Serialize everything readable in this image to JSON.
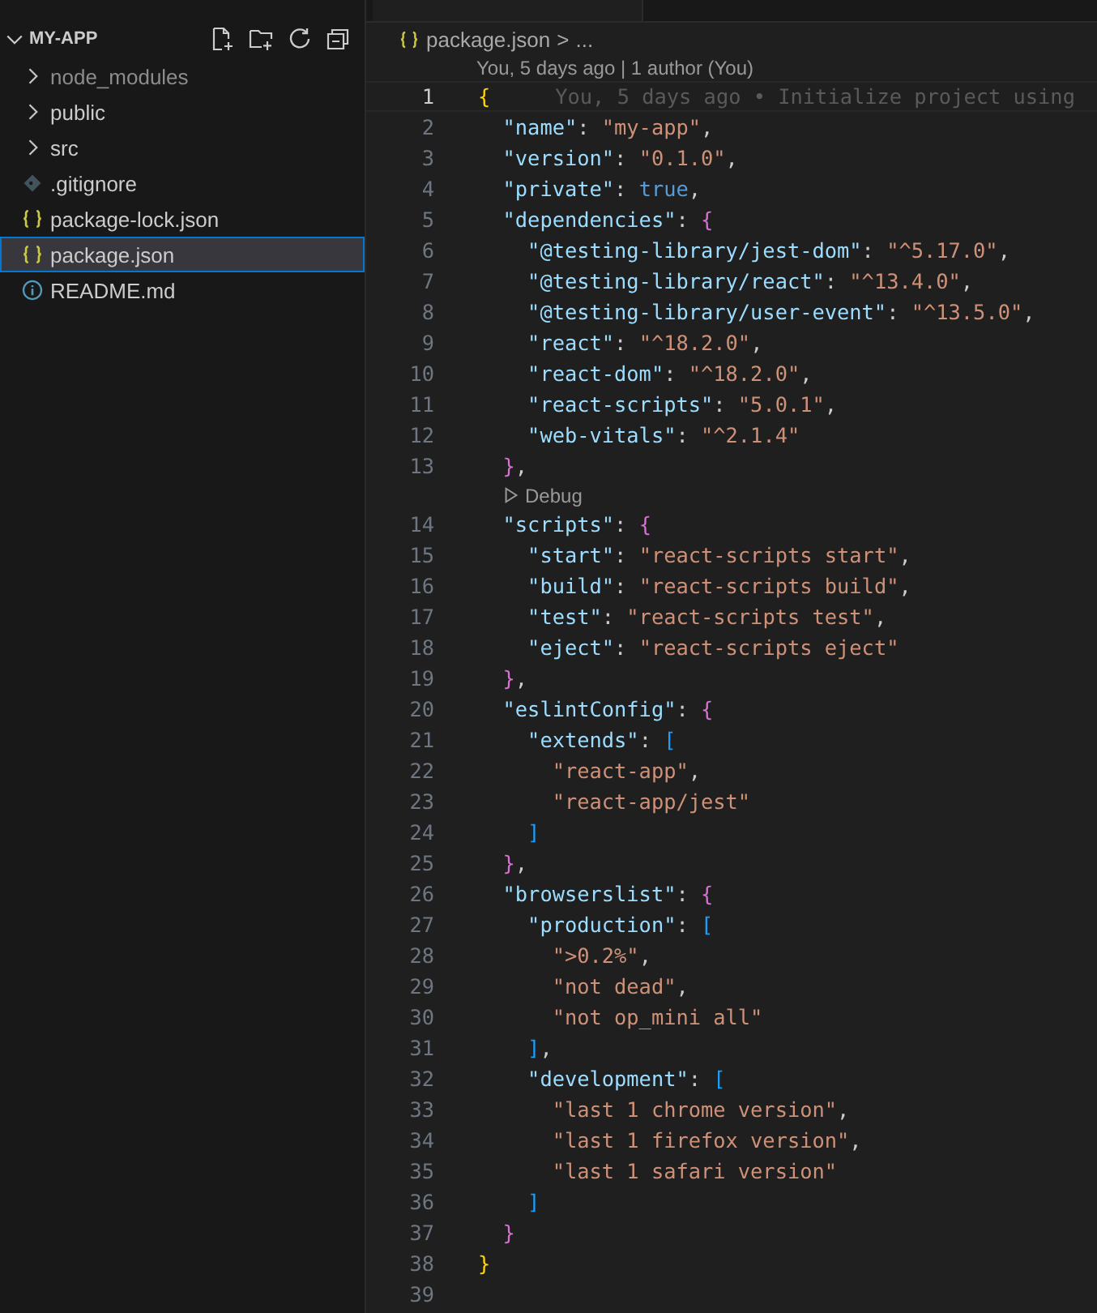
{
  "explorer": {
    "title": "MY-APP",
    "expanded": true,
    "items": [
      {
        "label": "node_modules",
        "kind": "folder",
        "ignored": true,
        "selected": false
      },
      {
        "label": "public",
        "kind": "folder",
        "ignored": false,
        "selected": false
      },
      {
        "label": "src",
        "kind": "folder",
        "ignored": false,
        "selected": false
      },
      {
        "label": ".gitignore",
        "kind": "git",
        "ignored": false,
        "selected": false
      },
      {
        "label": "package-lock.json",
        "kind": "json",
        "ignored": false,
        "selected": false
      },
      {
        "label": "package.json",
        "kind": "json",
        "ignored": false,
        "selected": true
      },
      {
        "label": "README.md",
        "kind": "info",
        "ignored": false,
        "selected": false
      }
    ]
  },
  "breadcrumb": {
    "file": "package.json",
    "separator": ">",
    "rest": "..."
  },
  "editor": {
    "items": [
      {
        "kind": "codelens",
        "text": "You, 5 days ago | 1 author (You)"
      },
      {
        "kind": "line",
        "number": "1",
        "current": true,
        "blame": "You, 5 days ago • Initialize project using",
        "tokens": [
          {
            "kind": "bracket",
            "text": "{",
            "color": "#ffd700"
          }
        ]
      },
      {
        "kind": "line",
        "number": "2",
        "current": false,
        "tokens": [
          {
            "kind": "key",
            "text": "  \"name\""
          },
          {
            "kind": "punct",
            "text": ": "
          },
          {
            "kind": "string",
            "text": "\"my-app\""
          },
          {
            "kind": "punct",
            "text": ","
          }
        ]
      },
      {
        "kind": "line",
        "number": "3",
        "current": false,
        "tokens": [
          {
            "kind": "key",
            "text": "  \"version\""
          },
          {
            "kind": "punct",
            "text": ": "
          },
          {
            "kind": "string",
            "text": "\"0.1.0\""
          },
          {
            "kind": "punct",
            "text": ","
          }
        ]
      },
      {
        "kind": "line",
        "number": "4",
        "current": false,
        "tokens": [
          {
            "kind": "key",
            "text": "  \"private\""
          },
          {
            "kind": "punct",
            "text": ": "
          },
          {
            "kind": "literal",
            "text": "true"
          },
          {
            "kind": "punct",
            "text": ","
          }
        ]
      },
      {
        "kind": "line",
        "number": "5",
        "current": false,
        "tokens": [
          {
            "kind": "key",
            "text": "  \"dependencies\""
          },
          {
            "kind": "punct",
            "text": ": "
          },
          {
            "kind": "bracket",
            "text": "{",
            "color": "#da70d6"
          }
        ]
      },
      {
        "kind": "line",
        "number": "6",
        "current": false,
        "tokens": [
          {
            "kind": "key",
            "text": "    \"@testing-library/jest-dom\""
          },
          {
            "kind": "punct",
            "text": ": "
          },
          {
            "kind": "string",
            "text": "\"^5.17.0\""
          },
          {
            "kind": "punct",
            "text": ","
          }
        ]
      },
      {
        "kind": "line",
        "number": "7",
        "current": false,
        "tokens": [
          {
            "kind": "key",
            "text": "    \"@testing-library/react\""
          },
          {
            "kind": "punct",
            "text": ": "
          },
          {
            "kind": "string",
            "text": "\"^13.4.0\""
          },
          {
            "kind": "punct",
            "text": ","
          }
        ]
      },
      {
        "kind": "line",
        "number": "8",
        "current": false,
        "tokens": [
          {
            "kind": "key",
            "text": "    \"@testing-library/user-event\""
          },
          {
            "kind": "punct",
            "text": ": "
          },
          {
            "kind": "string",
            "text": "\"^13.5.0\""
          },
          {
            "kind": "punct",
            "text": ","
          }
        ]
      },
      {
        "kind": "line",
        "number": "9",
        "current": false,
        "tokens": [
          {
            "kind": "key",
            "text": "    \"react\""
          },
          {
            "kind": "punct",
            "text": ": "
          },
          {
            "kind": "string",
            "text": "\"^18.2.0\""
          },
          {
            "kind": "punct",
            "text": ","
          }
        ]
      },
      {
        "kind": "line",
        "number": "10",
        "current": false,
        "tokens": [
          {
            "kind": "key",
            "text": "    \"react-dom\""
          },
          {
            "kind": "punct",
            "text": ": "
          },
          {
            "kind": "string",
            "text": "\"^18.2.0\""
          },
          {
            "kind": "punct",
            "text": ","
          }
        ]
      },
      {
        "kind": "line",
        "number": "11",
        "current": false,
        "tokens": [
          {
            "kind": "key",
            "text": "    \"react-scripts\""
          },
          {
            "kind": "punct",
            "text": ": "
          },
          {
            "kind": "string",
            "text": "\"5.0.1\""
          },
          {
            "kind": "punct",
            "text": ","
          }
        ]
      },
      {
        "kind": "line",
        "number": "12",
        "current": false,
        "tokens": [
          {
            "kind": "key",
            "text": "    \"web-vitals\""
          },
          {
            "kind": "punct",
            "text": ": "
          },
          {
            "kind": "string",
            "text": "\"^2.1.4\""
          }
        ]
      },
      {
        "kind": "line",
        "number": "13",
        "current": false,
        "tokens": [
          {
            "kind": "bracket",
            "text": "  }",
            "color": "#da70d6"
          },
          {
            "kind": "punct",
            "text": ","
          }
        ]
      },
      {
        "kind": "codelens",
        "text": "Debug",
        "run": true
      },
      {
        "kind": "line",
        "number": "14",
        "current": false,
        "tokens": [
          {
            "kind": "key",
            "text": "  \"scripts\""
          },
          {
            "kind": "punct",
            "text": ": "
          },
          {
            "kind": "bracket",
            "text": "{",
            "color": "#da70d6"
          }
        ]
      },
      {
        "kind": "line",
        "number": "15",
        "current": false,
        "tokens": [
          {
            "kind": "key",
            "text": "    \"start\""
          },
          {
            "kind": "punct",
            "text": ": "
          },
          {
            "kind": "string",
            "text": "\"react-scripts start\""
          },
          {
            "kind": "punct",
            "text": ","
          }
        ]
      },
      {
        "kind": "line",
        "number": "16",
        "current": false,
        "tokens": [
          {
            "kind": "key",
            "text": "    \"build\""
          },
          {
            "kind": "punct",
            "text": ": "
          },
          {
            "kind": "string",
            "text": "\"react-scripts build\""
          },
          {
            "kind": "punct",
            "text": ","
          }
        ]
      },
      {
        "kind": "line",
        "number": "17",
        "current": false,
        "tokens": [
          {
            "kind": "key",
            "text": "    \"test\""
          },
          {
            "kind": "punct",
            "text": ": "
          },
          {
            "kind": "string",
            "text": "\"react-scripts test\""
          },
          {
            "kind": "punct",
            "text": ","
          }
        ]
      },
      {
        "kind": "line",
        "number": "18",
        "current": false,
        "tokens": [
          {
            "kind": "key",
            "text": "    \"eject\""
          },
          {
            "kind": "punct",
            "text": ": "
          },
          {
            "kind": "string",
            "text": "\"react-scripts eject\""
          }
        ]
      },
      {
        "kind": "line",
        "number": "19",
        "current": false,
        "tokens": [
          {
            "kind": "bracket",
            "text": "  }",
            "color": "#da70d6"
          },
          {
            "kind": "punct",
            "text": ","
          }
        ]
      },
      {
        "kind": "line",
        "number": "20",
        "current": false,
        "tokens": [
          {
            "kind": "key",
            "text": "  \"eslintConfig\""
          },
          {
            "kind": "punct",
            "text": ": "
          },
          {
            "kind": "bracket",
            "text": "{",
            "color": "#da70d6"
          }
        ]
      },
      {
        "kind": "line",
        "number": "21",
        "current": false,
        "tokens": [
          {
            "kind": "key",
            "text": "    \"extends\""
          },
          {
            "kind": "punct",
            "text": ": "
          },
          {
            "kind": "bracket",
            "text": "[",
            "color": "#179fff"
          }
        ]
      },
      {
        "kind": "line",
        "number": "22",
        "current": false,
        "tokens": [
          {
            "kind": "string",
            "text": "      \"react-app\""
          },
          {
            "kind": "punct",
            "text": ","
          }
        ]
      },
      {
        "kind": "line",
        "number": "23",
        "current": false,
        "tokens": [
          {
            "kind": "string",
            "text": "      \"react-app/jest\""
          }
        ]
      },
      {
        "kind": "line",
        "number": "24",
        "current": false,
        "tokens": [
          {
            "kind": "bracket",
            "text": "    ]",
            "color": "#179fff"
          }
        ]
      },
      {
        "kind": "line",
        "number": "25",
        "current": false,
        "tokens": [
          {
            "kind": "bracket",
            "text": "  }",
            "color": "#da70d6"
          },
          {
            "kind": "punct",
            "text": ","
          }
        ]
      },
      {
        "kind": "line",
        "number": "26",
        "current": false,
        "tokens": [
          {
            "kind": "key",
            "text": "  \"browserslist\""
          },
          {
            "kind": "punct",
            "text": ": "
          },
          {
            "kind": "bracket",
            "text": "{",
            "color": "#da70d6"
          }
        ]
      },
      {
        "kind": "line",
        "number": "27",
        "current": false,
        "tokens": [
          {
            "kind": "key",
            "text": "    \"production\""
          },
          {
            "kind": "punct",
            "text": ": "
          },
          {
            "kind": "bracket",
            "text": "[",
            "color": "#179fff"
          }
        ]
      },
      {
        "kind": "line",
        "number": "28",
        "current": false,
        "tokens": [
          {
            "kind": "string",
            "text": "      \">0.2%\""
          },
          {
            "kind": "punct",
            "text": ","
          }
        ]
      },
      {
        "kind": "line",
        "number": "29",
        "current": false,
        "tokens": [
          {
            "kind": "string",
            "text": "      \"not dead\""
          },
          {
            "kind": "punct",
            "text": ","
          }
        ]
      },
      {
        "kind": "line",
        "number": "30",
        "current": false,
        "tokens": [
          {
            "kind": "string",
            "text": "      \"not op_mini all\""
          }
        ]
      },
      {
        "kind": "line",
        "number": "31",
        "current": false,
        "tokens": [
          {
            "kind": "bracket",
            "text": "    ]",
            "color": "#179fff"
          },
          {
            "kind": "punct",
            "text": ","
          }
        ]
      },
      {
        "kind": "line",
        "number": "32",
        "current": false,
        "tokens": [
          {
            "kind": "key",
            "text": "    \"development\""
          },
          {
            "kind": "punct",
            "text": ": "
          },
          {
            "kind": "bracket",
            "text": "[",
            "color": "#179fff"
          }
        ]
      },
      {
        "kind": "line",
        "number": "33",
        "current": false,
        "tokens": [
          {
            "kind": "string",
            "text": "      \"last 1 chrome version\""
          },
          {
            "kind": "punct",
            "text": ","
          }
        ]
      },
      {
        "kind": "line",
        "number": "34",
        "current": false,
        "tokens": [
          {
            "kind": "string",
            "text": "      \"last 1 firefox version\""
          },
          {
            "kind": "punct",
            "text": ","
          }
        ]
      },
      {
        "kind": "line",
        "number": "35",
        "current": false,
        "tokens": [
          {
            "kind": "string",
            "text": "      \"last 1 safari version\""
          }
        ]
      },
      {
        "kind": "line",
        "number": "36",
        "current": false,
        "tokens": [
          {
            "kind": "bracket",
            "text": "    ]",
            "color": "#179fff"
          }
        ]
      },
      {
        "kind": "line",
        "number": "37",
        "current": false,
        "tokens": [
          {
            "kind": "bracket",
            "text": "  }",
            "color": "#da70d6"
          }
        ]
      },
      {
        "kind": "line",
        "number": "38",
        "current": false,
        "tokens": [
          {
            "kind": "bracket",
            "text": "}",
            "color": "#ffd700"
          }
        ]
      },
      {
        "kind": "line",
        "number": "39",
        "current": false
      }
    ]
  }
}
